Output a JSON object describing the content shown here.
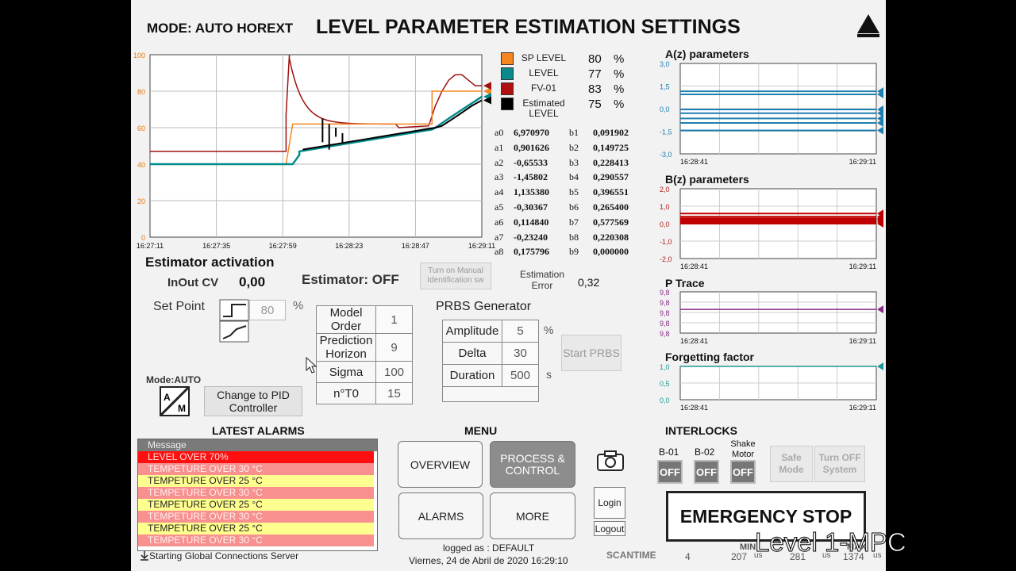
{
  "header": {
    "mode_label": "MODE: AUTO HOREXT",
    "title": "LEVEL PARAMETER ESTIMATION SETTINGS"
  },
  "main_chart": {
    "y_ticks": [
      "100",
      "80",
      "60",
      "40",
      "20",
      "0"
    ],
    "x_ticks": [
      "16:27:11",
      "16:27:35",
      "16:27:59",
      "16:28:23",
      "16:28:47",
      "16:29:11"
    ],
    "colors": {
      "sp": "#f5861f",
      "level": "#008b8b",
      "fv": "#a01010",
      "est": "#000000"
    }
  },
  "legend": [
    {
      "label": "SP LEVEL",
      "value": "80",
      "unit": "%",
      "color": "#f5861f"
    },
    {
      "label": "LEVEL",
      "value": "77",
      "unit": "%",
      "color": "#0a8a8a"
    },
    {
      "label": "FV-01",
      "value": "83",
      "unit": "%",
      "color": "#b01010"
    },
    {
      "label": "Estimated LEVEL",
      "value": "75",
      "unit": "%",
      "color": "#000000"
    }
  ],
  "coefficients": [
    {
      "a": "a0",
      "av": "6,970970",
      "b": "b1",
      "bv": "0,091902"
    },
    {
      "a": "a1",
      "av": "0,901626",
      "b": "b2",
      "bv": "0,149725"
    },
    {
      "a": "a2",
      "av": "-0,65533",
      "b": "b3",
      "bv": "0,228413"
    },
    {
      "a": "a3",
      "av": "-1,45802",
      "b": "b4",
      "bv": "0,290557"
    },
    {
      "a": "a4",
      "av": "1,135380",
      "b": "b5",
      "bv": "0,396551"
    },
    {
      "a": "a5",
      "av": "-0,30367",
      "b": "b6",
      "bv": "0,265400"
    },
    {
      "a": "a6",
      "av": "0,114840",
      "b": "b7",
      "bv": "0,577569"
    },
    {
      "a": "a7",
      "av": "-0,23240",
      "b": "b8",
      "bv": "0,220308"
    },
    {
      "a": "a8",
      "av": "0,175796",
      "b": "b9",
      "bv": "0,000000"
    }
  ],
  "estimation_error": {
    "label": "Estimation Error",
    "value": "0,32"
  },
  "estimator": {
    "section_title": "Estimator activation",
    "inout_label": "InOut CV",
    "inout_value": "0,00",
    "status": "Estimator: OFF",
    "manual_button": "Turn on Manual Identification sw",
    "setpoint_label": "Set Point",
    "setpoint_value": "80",
    "setpoint_unit": "%",
    "mode_label": "Mode:AUTO",
    "am_a": "A",
    "am_m": "M",
    "pid_button": "Change to PID Controller"
  },
  "model_params": [
    {
      "label": "Model Order",
      "value": "1"
    },
    {
      "label": "Prediction Horizon",
      "value": "9"
    },
    {
      "label": "Sigma",
      "value": "100"
    },
    {
      "label": "n°T0",
      "value": "15"
    }
  ],
  "prbs": {
    "title": "PRBS Generator",
    "rows": [
      {
        "label": "Amplitude",
        "value": "5",
        "unit": "%"
      },
      {
        "label": "Delta",
        "value": "30",
        "unit": ""
      },
      {
        "label": "Duration",
        "value": "500",
        "unit": "s"
      }
    ],
    "start_button": "Start PRBS"
  },
  "right_charts": {
    "az": {
      "title": "A(z) parameters",
      "y_ticks": [
        "3,0",
        "1,5",
        "0,0",
        "-1,5",
        "-3,0"
      ],
      "x_start": "16:28:41",
      "x_end": "16:29:11",
      "values": [
        1.15,
        0.95,
        -0.05,
        -0.3,
        -0.65,
        -0.95,
        -1.45
      ],
      "color": "#1f7fb0"
    },
    "bz": {
      "title": "B(z) parameters",
      "y_ticks": [
        "2,0",
        "1,0",
        "0,0",
        "-1,0",
        "-2,0"
      ],
      "x_start": "16:28:41",
      "x_end": "16:29:11",
      "values": [
        0.58,
        0.4,
        0.3,
        0.27,
        0.23,
        0.15,
        0.09,
        0.0
      ],
      "color": "#c00000"
    },
    "ptrace": {
      "title": "P Trace",
      "y_ticks": [
        "9,8",
        "9,8",
        "9,8",
        "9,8",
        "9,8"
      ],
      "x_start": "16:28:41",
      "x_end": "16:29:11",
      "color": "#8b2a8b"
    },
    "ff": {
      "title": "Forgetting factor",
      "y_ticks": [
        "1,0",
        "0,5",
        "0,0"
      ],
      "x_start": "16:28:41",
      "x_end": "16:29:11",
      "value": 1.0,
      "color": "#1a9a9a"
    }
  },
  "alarms": {
    "title": "LATEST ALARMS",
    "header": "Message",
    "rows": [
      {
        "text": "LEVEL OVER 70%",
        "bg": "#ff1010",
        "fg": "#ffdede"
      },
      {
        "text": "TEMPETURE OVER 30 °C",
        "bg": "#f89090",
        "fg": "#fff2f2"
      },
      {
        "text": "TEMPETURE OVER 25 °C",
        "bg": "#ffff90",
        "fg": "#222222"
      },
      {
        "text": "TEMPETURE OVER 30 °C",
        "bg": "#f89090",
        "fg": "#fff2f2"
      },
      {
        "text": "TEMPETURE OVER 25 °C",
        "bg": "#ffff90",
        "fg": "#222222"
      },
      {
        "text": "TEMPETURE OVER 30 °C",
        "bg": "#f89090",
        "fg": "#fff2f2"
      },
      {
        "text": "TEMPETURE OVER 25 °C",
        "bg": "#ffff90",
        "fg": "#222222"
      },
      {
        "text": "TEMPETURE OVER 30 °C",
        "bg": "#f89090",
        "fg": "#fff2f2"
      }
    ],
    "status": "Starting Global Connections Server"
  },
  "menu": {
    "title": "MENU",
    "overview": "OVERVIEW",
    "process": "PROCESS & CONTROL",
    "alarms": "ALARMS",
    "more": "MORE",
    "login": "Login",
    "logout": "Logout",
    "logged_as": "logged as : DEFAULT",
    "datetime": "Viernes, 24 de Abril de 2020 16:29:10"
  },
  "interlocks": {
    "title": "INTERLOCKS",
    "items": [
      {
        "label": "B-01",
        "state": "OFF"
      },
      {
        "label": "B-02",
        "state": "OFF"
      },
      {
        "label": "Shake Motor",
        "state": "OFF"
      }
    ],
    "safe_mode": "Safe Mode",
    "turn_off": "Turn OFF System",
    "emergency": "EMERGENCY STOP"
  },
  "scantime": {
    "label": "SCANTIME",
    "value": "4",
    "min_label": "MIN",
    "min_value": "207",
    "min_unit": "us",
    "avg_value": "281",
    "avg_unit": "us",
    "max_label": "MAX",
    "max_value": "1374",
    "max_unit": "us"
  },
  "watermark": "Level 1-MPC"
}
